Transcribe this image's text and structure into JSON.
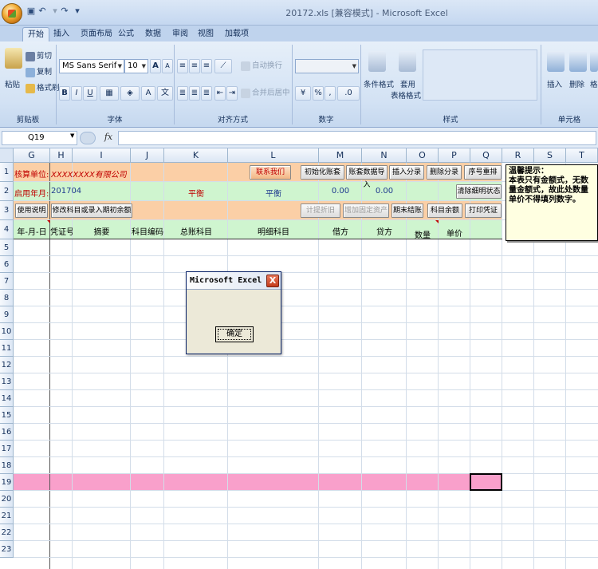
{
  "window": {
    "title": "20172.xls  [兼容模式] - Microsoft Excel"
  },
  "tabs": [
    "开始",
    "插入",
    "页面布局",
    "公式",
    "数据",
    "审阅",
    "视图",
    "加载项"
  ],
  "ribbon": {
    "clipboard": {
      "paste": "粘贴",
      "cut": "剪切",
      "copy": "复制",
      "format_painter": "格式刷",
      "label": "剪贴板"
    },
    "font": {
      "name": "MS Sans Serif",
      "size": "10",
      "label": "字体",
      "bold": "B",
      "italic": "I",
      "underline": "U",
      "grow": "A",
      "shrink": "A"
    },
    "alignment": {
      "wrap": "自动换行",
      "merge": "合并后居中",
      "label": "对齐方式"
    },
    "number": {
      "percent": "%",
      "comma": ",",
      "label": "数字"
    },
    "styles": {
      "conditional": "条件格式",
      "table": "套用",
      "table2": "表格格式",
      "label": "样式"
    },
    "cells": {
      "insert": "插入",
      "delete": "删除",
      "format": "格式",
      "label": "单元格"
    }
  },
  "formula_bar": {
    "name_box": "Q19",
    "fx": "fx",
    "value": ""
  },
  "columns": [
    "G",
    "H",
    "I",
    "J",
    "K",
    "L",
    "M",
    "N",
    "O",
    "P",
    "Q",
    "R",
    "S",
    "T"
  ],
  "rows": [
    "1",
    "2",
    "3",
    "4",
    "5",
    "6",
    "7",
    "8",
    "9",
    "10",
    "11",
    "12",
    "13",
    "14",
    "15",
    "16",
    "17",
    "18",
    "19",
    "20",
    "21",
    "22",
    "23"
  ],
  "sheet": {
    "r1": {
      "label": "核算单位:",
      "company": "XXXXXXXX有限公司",
      "contact_btn": "联系我们",
      "init_btn": "初始化账套",
      "import_btn": "账套数据导入",
      "insert_btn": "插入分录",
      "delete_btn": "删除分录",
      "renumber_btn": "序号重排"
    },
    "r2": {
      "label": "启用年月:",
      "period": "201704",
      "balance1": "平衡",
      "balance2": "平衡",
      "debit": "0.00",
      "credit": "0.00",
      "clear_btn": "清除细明状态"
    },
    "r3": {
      "help_btn": "使用说明",
      "edit_btn": "修改科目或录入期初余额",
      "depreciation_btn": "计提折旧",
      "add_asset_btn": "增加固定资产",
      "closing_btn": "期末结账",
      "balance_btn": "科目余额",
      "print_btn": "打印凭证"
    },
    "r4": {
      "date": "年-月-日",
      "voucher": "凭证号",
      "summary": "摘要",
      "code": "科目编码",
      "general": "总账科目",
      "detail": "明细科目",
      "debit": "借方",
      "credit": "贷方",
      "qty": "数量",
      "price": "单价"
    }
  },
  "tip": {
    "title": "温馨提示：",
    "body": "本表只有金额式，无数量金额式，故此处数量单价不得填列数字。"
  },
  "dialog": {
    "title": "Microsoft Excel",
    "close": "X",
    "ok": "确定"
  }
}
